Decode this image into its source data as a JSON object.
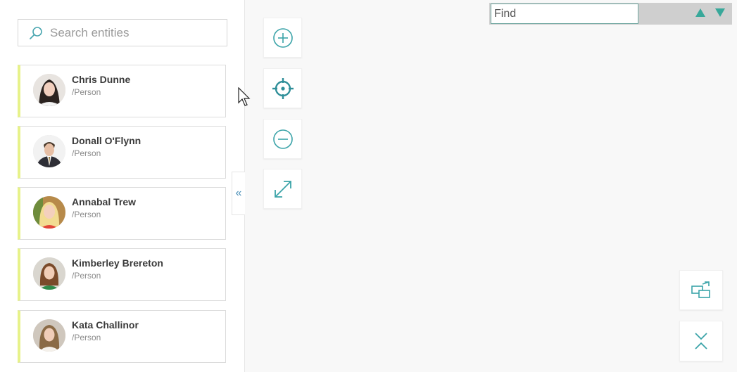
{
  "search": {
    "placeholder": "Search entities",
    "icon": "search-icon"
  },
  "entities": [
    {
      "name": "Chris Dunne",
      "type": "/Person"
    },
    {
      "name": "Donall O'Flynn",
      "type": "/Person"
    },
    {
      "name": "Annabal Trew",
      "type": "/Person"
    },
    {
      "name": "Kimberley Brereton",
      "type": "/Person"
    },
    {
      "name": "Kata Challinor",
      "type": "/Person"
    }
  ],
  "collapse": {
    "label": "«"
  },
  "toolbar": {
    "zoom_in": "zoom-in-icon",
    "center": "crosshair-icon",
    "zoom_out": "zoom-out-icon",
    "fit": "expand-icon",
    "layout": "layout-switch-icon",
    "collapse_all": "collapse-icon"
  },
  "find": {
    "placeholder": "Find"
  },
  "colors": {
    "accent": "#38a89a",
    "card_stripe": "#e7f28a",
    "icon": "#3aa3a8"
  }
}
